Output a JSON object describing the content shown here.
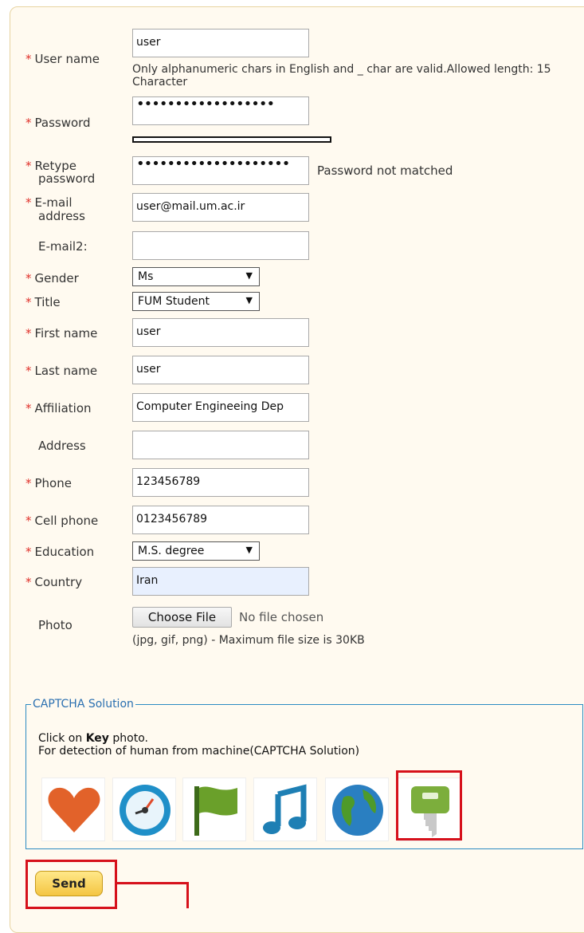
{
  "form": {
    "required_mark": "*",
    "username": {
      "label": "User name",
      "value": "user",
      "hint": "Only alphanumeric chars in English and _ char are valid.Allowed length: 15 Character"
    },
    "password": {
      "label": "Password",
      "value": "••••••••••••••••••"
    },
    "retype_password": {
      "label_line1": "Retype",
      "label_line2": "password",
      "value": "••••••••••••••••••••",
      "error": "Password not matched"
    },
    "email": {
      "label_line1": "E-mail",
      "label_line2": "address",
      "value": "user@mail.um.ac.ir"
    },
    "email2": {
      "label": "E-mail2:",
      "value": ""
    },
    "gender": {
      "label": "Gender",
      "value": "Ms"
    },
    "title": {
      "label": "Title",
      "value": "FUM Student"
    },
    "first_name": {
      "label": "First name",
      "value": "user"
    },
    "last_name": {
      "label": "Last name",
      "value": "user"
    },
    "affiliation": {
      "label": "Affiliation",
      "value": "Computer Engineeing Dep"
    },
    "address": {
      "label": "Address",
      "value": ""
    },
    "phone": {
      "label": "Phone",
      "value": "123456789"
    },
    "cell_phone": {
      "label": "Cell phone",
      "value": "0123456789"
    },
    "education": {
      "label": "Education",
      "value": "M.S. degree"
    },
    "country": {
      "label": "Country",
      "value": "Iran"
    },
    "photo": {
      "label": "Photo",
      "button": "Choose File",
      "status": "No file chosen",
      "hint": "(jpg, gif, png) - Maximum file size is 30KB"
    }
  },
  "captcha": {
    "legend": "CAPTCHA Solution",
    "instruction_prefix": "Click on ",
    "instruction_key": "Key",
    "instruction_suffix": " photo.",
    "description": "For detection of human from machine(CAPTCHA Solution)",
    "icons": [
      "heart-icon",
      "clock-icon",
      "flag-icon",
      "music-note-icon",
      "globe-icon",
      "key-icon"
    ],
    "selected": "key-icon"
  },
  "send_label": "Send",
  "colors": {
    "required": "#e0312b",
    "highlight": "#d6111b",
    "panel_bg": "#fffaf0",
    "captcha_border": "#2c8bc2",
    "button": "#f4c542"
  }
}
